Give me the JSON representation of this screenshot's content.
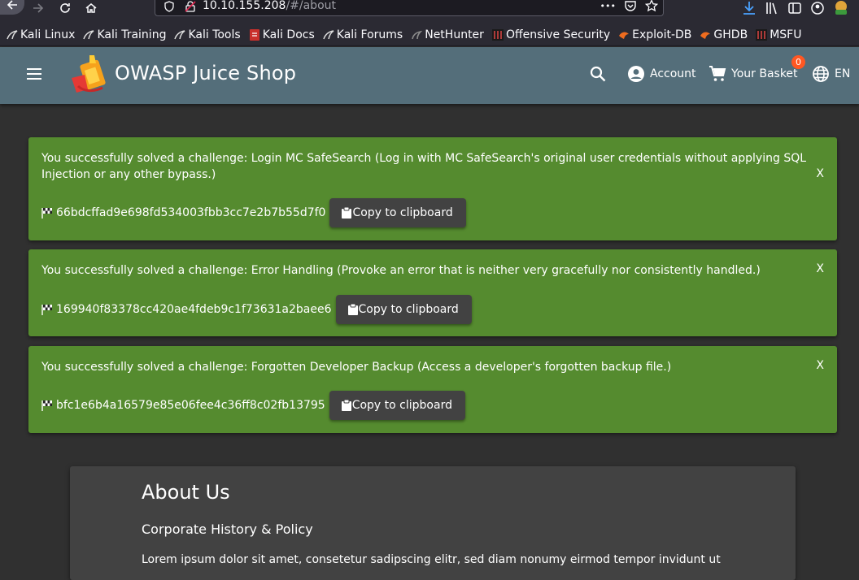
{
  "browser": {
    "url_host": "10.10.155.208",
    "url_path": "/#/about",
    "ellipsis": "•••"
  },
  "bookmarks": [
    {
      "label": "Kali Linux",
      "icon": "kali-dragon-icon"
    },
    {
      "label": "Kali Training",
      "icon": "kali-dragon-icon"
    },
    {
      "label": "Kali Tools",
      "icon": "kali-dragon-icon"
    },
    {
      "label": "Kali Docs",
      "icon": "kali-docs-icon"
    },
    {
      "label": "Kali Forums",
      "icon": "kali-dragon-icon"
    },
    {
      "label": "NetHunter",
      "icon": "nethunter-icon"
    },
    {
      "label": "Offensive Security",
      "icon": "offsec-icon"
    },
    {
      "label": "Exploit-DB",
      "icon": "exploitdb-icon"
    },
    {
      "label": "GHDB",
      "icon": "exploitdb-icon"
    },
    {
      "label": "MSFU",
      "icon": "offsec-icon"
    }
  ],
  "toolbar": {
    "title": "OWASP Juice Shop",
    "account_label": "Account",
    "basket_label": "Your Basket",
    "basket_count": "0",
    "language": "EN"
  },
  "notifications": [
    {
      "message": "You successfully solved a challenge: Login MC SafeSearch (Log in with MC SafeSearch's original user credentials without applying SQL Injection or any other bypass.)",
      "flag": "66bdcffad9e698fd534003fbb3cc7e2b7b55d7f0",
      "copy_label": "Copy to clipboard",
      "close_label": "X"
    },
    {
      "message": "You successfully solved a challenge: Error Handling (Provoke an error that is neither very gracefully nor consistently handled.)",
      "flag": "169940f83378cc420ae4fdeb9c1f73631a2baee6",
      "copy_label": "Copy to clipboard",
      "close_label": "X"
    },
    {
      "message": "You successfully solved a challenge: Forgotten Developer Backup (Access a developer's forgotten backup file.)",
      "flag": "bfc1e6b4a16579e85e06fee4c36ff8c02fb13795",
      "copy_label": "Copy to clipboard",
      "close_label": "X"
    }
  ],
  "about": {
    "title": "About Us",
    "subtitle": "Corporate History & Policy",
    "text": "Lorem ipsum dolor sit amet, consetetur sadipscing elitr, sed diam nonumy eirmod tempor invidunt ut"
  },
  "colors": {
    "toolbar": "#546e7a",
    "notice": "#558b2f",
    "badge": "#ff5722",
    "background": "#303030",
    "card": "#424242"
  }
}
